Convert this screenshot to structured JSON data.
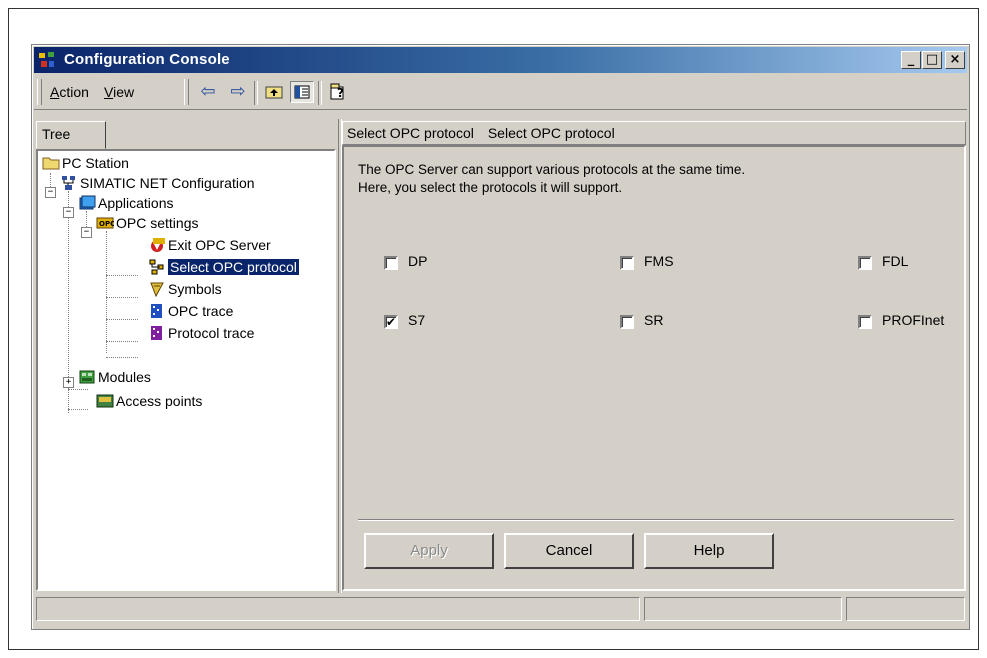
{
  "window": {
    "title": "Configuration Console",
    "controls": {
      "minimize": "_",
      "maximize": "□",
      "close": "×"
    }
  },
  "menu": {
    "action": "Action",
    "action_key": "A",
    "view": "View",
    "view_key": "V"
  },
  "tree": {
    "tab_label": "Tree",
    "nodes": [
      {
        "label": "PC Station",
        "icon": "folder-icon"
      },
      {
        "label": "SIMATIC NET Configuration",
        "icon": "network-icon"
      },
      {
        "label": "Applications",
        "icon": "applications-icon"
      },
      {
        "label": "OPC settings",
        "icon": "opc-icon"
      },
      {
        "label": "Exit OPC Server",
        "icon": "exit-opc-server-icon"
      },
      {
        "label": "Select OPC protocol",
        "icon": "protocol-icon",
        "selected": true
      },
      {
        "label": "Symbols",
        "icon": "symbols-icon"
      },
      {
        "label": "OPC trace",
        "icon": "trace-icon"
      },
      {
        "label": "Protocol trace",
        "icon": "protocol-trace-icon"
      },
      {
        "label": "Modules",
        "icon": "modules-icon"
      },
      {
        "label": "Access points",
        "icon": "access-points-icon"
      }
    ]
  },
  "header": {
    "crumb1": "Select OPC protocol",
    "crumb2": "Select OPC protocol"
  },
  "content": {
    "line1": "The OPC Server can support various protocols at the same time.",
    "line2": "Here, you select the protocols it will support.",
    "protocols": [
      {
        "label": "DP",
        "checked": false
      },
      {
        "label": "FMS",
        "checked": false
      },
      {
        "label": "FDL",
        "checked": false
      },
      {
        "label": "S7",
        "checked": true
      },
      {
        "label": "SR",
        "checked": false
      },
      {
        "label": "PROFInet",
        "checked": false
      }
    ]
  },
  "buttons": {
    "apply": "Apply",
    "cancel": "Cancel",
    "help": "Help"
  },
  "colors": {
    "titlebar_start": "#0a246a",
    "titlebar_end": "#a6caf0",
    "face": "#d4d0c8",
    "selection": "#0a246a"
  }
}
